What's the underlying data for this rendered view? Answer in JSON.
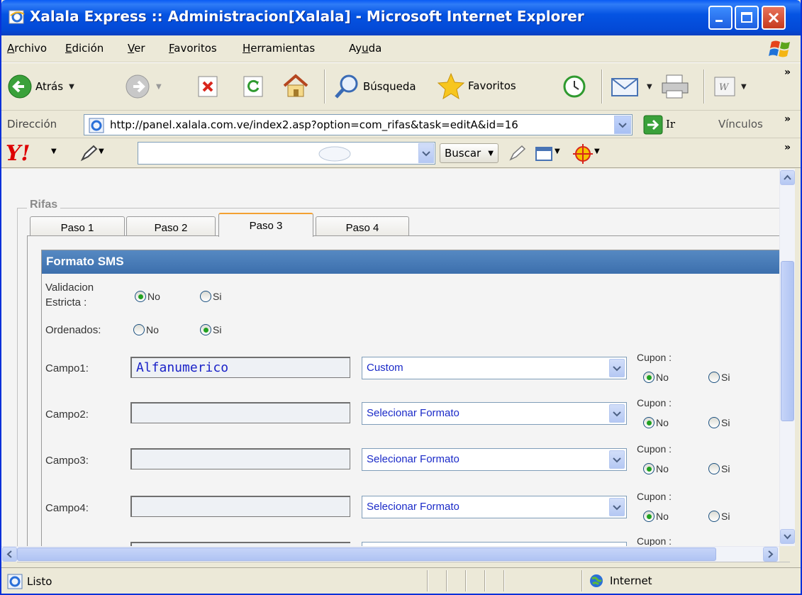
{
  "window": {
    "title": "Xalala Express :: Administracion[Xalala] - Microsoft Internet Explorer"
  },
  "menu": [
    {
      "label": "Archivo",
      "accel": "A",
      "rest": "rchivo"
    },
    {
      "label": "Edición",
      "accel": "E",
      "rest": "dición"
    },
    {
      "label": "Ver",
      "accel": "V",
      "rest": "er"
    },
    {
      "label": "Favoritos",
      "accel": "F",
      "rest": "avoritos"
    },
    {
      "label": "Herramientas",
      "accel": "H",
      "rest": "erramientas"
    },
    {
      "label": "Ayuda",
      "pre": "Ay",
      "accel": "u",
      "rest": "da"
    }
  ],
  "toolbar": {
    "back_label": "Atrás",
    "search_label": "Búsqueda",
    "favorites_label": "Favoritos"
  },
  "address": {
    "label": "Dirección",
    "url": "http://panel.xalala.com.ve/index2.asp?option=com_rifas&task=editA&id=16",
    "go_label": "Ir",
    "links_label": "Vínculos"
  },
  "yahoo": {
    "logo": "Y!",
    "search_value": "",
    "search_button": "Buscar"
  },
  "form": {
    "legend": "Rifas",
    "tabs": [
      "Paso 1",
      "Paso 2",
      "Paso 3",
      "Paso 4"
    ],
    "active_tab": "Paso 3",
    "header": "Formato SMS",
    "validacion_label_1": "Validacion",
    "validacion_label_2": "Estricta :",
    "ordenados_label": "Ordenados:",
    "radio_no": "No",
    "radio_si": "Si",
    "validacion_value": "No",
    "ordenados_value": "Si",
    "cupon_label": "Cupon :",
    "campos": [
      {
        "label": "Campo1:",
        "value": "Alfanumerico",
        "format": "Custom",
        "cupon": "No"
      },
      {
        "label": "Campo2:",
        "value": "",
        "format": "Selecionar Formato",
        "cupon": "No"
      },
      {
        "label": "Campo3:",
        "value": "",
        "format": "Selecionar Formato",
        "cupon": "No"
      },
      {
        "label": "Campo4:",
        "value": "",
        "format": "Selecionar Formato",
        "cupon": "No"
      }
    ],
    "partial_cupon": "Cupon :"
  },
  "status": {
    "text": "Listo",
    "zone": "Internet"
  }
}
